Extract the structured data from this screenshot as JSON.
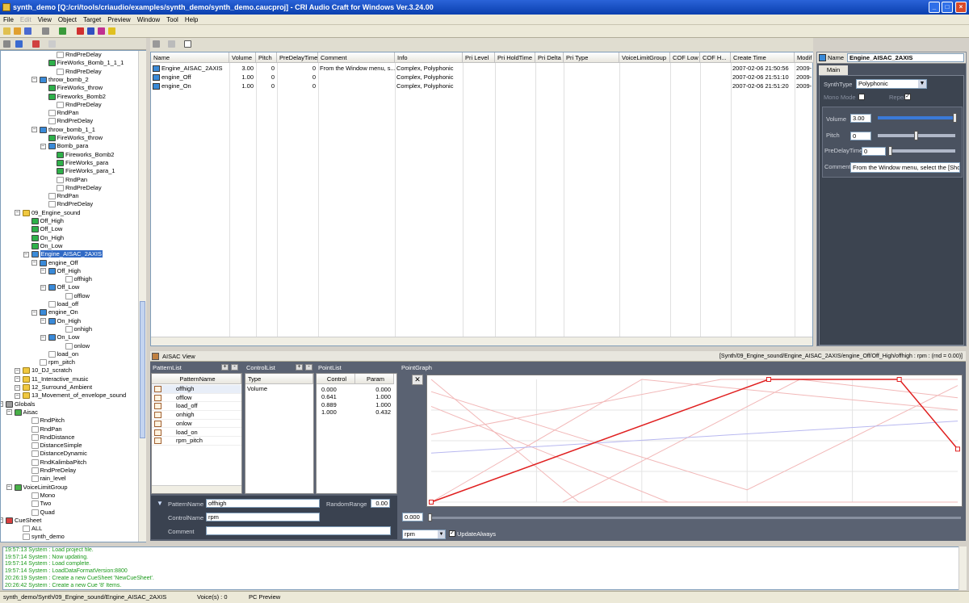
{
  "window": {
    "title": "synth_demo [Q:/cri/tools/criaudio/examples/synth_demo/synth_demo.caucproj] - CRI Audio Craft for Windows Ver.3.24.00"
  },
  "menu": [
    {
      "label": "File",
      "disabled": false
    },
    {
      "label": "Edit",
      "disabled": true
    },
    {
      "label": "View",
      "disabled": false
    },
    {
      "label": "Object",
      "disabled": false
    },
    {
      "label": "Target",
      "disabled": false
    },
    {
      "label": "Preview",
      "disabled": false
    },
    {
      "label": "Window",
      "disabled": false
    },
    {
      "label": "Tool",
      "disabled": false
    },
    {
      "label": "Help",
      "disabled": false
    }
  ],
  "tree": [
    {
      "label": "RndPreDelay",
      "icon": "d",
      "indent": 6
    },
    {
      "label": "FireWorks_Bomb_1_1_1",
      "icon": "g",
      "indent": 5
    },
    {
      "label": "RndPreDelay",
      "icon": "d",
      "indent": 6
    },
    {
      "label": "throw_bomb_2",
      "icon": "b",
      "indent": 4
    },
    {
      "label": "FireWorks_throw",
      "icon": "g",
      "indent": 5
    },
    {
      "label": "Fireworks_Bomb2",
      "icon": "g",
      "indent": 5
    },
    {
      "label": "RndPreDelay",
      "icon": "d",
      "indent": 6
    },
    {
      "label": "RndPan",
      "icon": "d",
      "indent": 5
    },
    {
      "label": "RndPreDelay",
      "icon": "d",
      "indent": 5
    },
    {
      "label": "throw_bomb_1_1",
      "icon": "b",
      "indent": 4
    },
    {
      "label": "FireWorks_throw",
      "icon": "g",
      "indent": 5
    },
    {
      "label": "Bomb_para",
      "icon": "b",
      "indent": 5
    },
    {
      "label": "Fireworks_Bomb2",
      "icon": "g",
      "indent": 6
    },
    {
      "label": "FireWorks_para",
      "icon": "g",
      "indent": 6
    },
    {
      "label": "FireWorks_para_1",
      "icon": "g",
      "indent": 6
    },
    {
      "label": "RndPan",
      "icon": "d",
      "indent": 6
    },
    {
      "label": "RndPreDelay",
      "icon": "d",
      "indent": 6
    },
    {
      "label": "RndPan",
      "icon": "d",
      "indent": 5
    },
    {
      "label": "RndPreDelay",
      "icon": "d",
      "indent": 5
    },
    {
      "label": "09_Engine_sound",
      "icon": "f",
      "indent": 2
    },
    {
      "label": "Off_High",
      "icon": "g",
      "indent": 3
    },
    {
      "label": "Off_Low",
      "icon": "g",
      "indent": 3
    },
    {
      "label": "On_High",
      "icon": "g",
      "indent": 3
    },
    {
      "label": "On_Low",
      "icon": "g",
      "indent": 3
    },
    {
      "label": "Engine_AISAC_2AXIS",
      "icon": "b",
      "indent": 3,
      "selected": true
    },
    {
      "label": "engine_Off",
      "icon": "b",
      "indent": 4
    },
    {
      "label": "Off_High",
      "icon": "b",
      "indent": 5
    },
    {
      "label": "offhigh",
      "icon": "d",
      "indent": 7
    },
    {
      "label": "Off_Low",
      "icon": "b",
      "indent": 5
    },
    {
      "label": "offlow",
      "icon": "d",
      "indent": 7
    },
    {
      "label": "load_off",
      "icon": "d",
      "indent": 5
    },
    {
      "label": "engine_On",
      "icon": "b",
      "indent": 4
    },
    {
      "label": "On_High",
      "icon": "b",
      "indent": 5
    },
    {
      "label": "onhigh",
      "icon": "d",
      "indent": 7
    },
    {
      "label": "On_Low",
      "icon": "b",
      "indent": 5
    },
    {
      "label": "onlow",
      "icon": "d",
      "indent": 7
    },
    {
      "label": "load_on",
      "icon": "d",
      "indent": 5
    },
    {
      "label": "rpm_pitch",
      "icon": "d",
      "indent": 4
    },
    {
      "label": "10_DJ_scratch",
      "icon": "f",
      "indent": 2
    },
    {
      "label": "11_Interactive_music",
      "icon": "f",
      "indent": 2
    },
    {
      "label": "12_Surround_Ambient",
      "icon": "f",
      "indent": 2
    },
    {
      "label": "13_Movement_of_envelope_sound",
      "icon": "f",
      "indent": 2
    },
    {
      "label": "Globals",
      "icon": "gf",
      "indent": 0
    },
    {
      "label": "Aisac",
      "icon": "gr",
      "indent": 1
    },
    {
      "label": "RndPitch",
      "icon": "d",
      "indent": 3
    },
    {
      "label": "RndPan",
      "icon": "d",
      "indent": 3
    },
    {
      "label": "RndDistance",
      "icon": "d",
      "indent": 3
    },
    {
      "label": "DistanceSimple",
      "icon": "d",
      "indent": 3
    },
    {
      "label": "DistanceDynamic",
      "icon": "d",
      "indent": 3
    },
    {
      "label": "RndKalimbaPitch",
      "icon": "d",
      "indent": 3
    },
    {
      "label": "RndPreDelay",
      "icon": "d",
      "indent": 3
    },
    {
      "label": "rain_level",
      "icon": "d",
      "indent": 3
    },
    {
      "label": "VoiceLimitGroup",
      "icon": "gr",
      "indent": 1
    },
    {
      "label": "Mono",
      "icon": "d",
      "indent": 3
    },
    {
      "label": "Two",
      "icon": "d",
      "indent": 3
    },
    {
      "label": "Quad",
      "icon": "d",
      "indent": 3
    },
    {
      "label": "CueSheet",
      "icon": "r",
      "indent": 0
    },
    {
      "label": "ALL",
      "icon": "d",
      "indent": 2
    },
    {
      "label": "synth_demo",
      "icon": "d",
      "indent": 2
    }
  ],
  "table": {
    "columns": [
      "Name",
      "Volume",
      "Pitch",
      "PreDelayTime",
      "Comment",
      "Info",
      "Pri Level",
      "Pri HoldTime",
      "Pri Delta",
      "Pri Type",
      "VoiceLimitGroup",
      "COF Low",
      "COF H...",
      "Create Time",
      "Modif"
    ],
    "rows": [
      [
        "Engine_AISAC_2AXIS",
        "3.00",
        "0",
        "0",
        "From the Window menu, s...",
        "Complex, Polyphonic",
        "",
        "",
        "",
        "",
        "",
        "",
        "",
        "2007-02-06 21:50:56",
        "2009-"
      ],
      [
        "engine_Off",
        "1.00",
        "0",
        "0",
        "",
        "Complex, Polyphonic",
        "",
        "",
        "",
        "",
        "",
        "",
        "",
        "2007-02-06 21:51:10",
        "2009-"
      ],
      [
        "engine_On",
        "1.00",
        "0",
        "0",
        "",
        "Complex, Polyphonic",
        "",
        "",
        "",
        "",
        "",
        "",
        "",
        "2007-02-06 21:51:20",
        "2009-"
      ]
    ]
  },
  "props": {
    "name_label": "Name",
    "name_value": "Engine_AISAC_2AXIS",
    "tab": "Main",
    "synth_type_label": "SynthType",
    "synth_type_value": "Polyphonic",
    "mono_label": "Mono Mode",
    "repeat_label": "Repeat",
    "volume_label": "Volume",
    "volume_value": "3.00",
    "volume_level": 1.0,
    "pitch_label": "Pitch",
    "pitch_value": "0",
    "pitch_level": 0.5,
    "predelay_label": "PreDelayTime",
    "predelay_value": "0",
    "predelay_level": 0.0,
    "comment_label": "Comment",
    "comment_value": "From the Window menu, select the [Show A"
  },
  "aisac": {
    "title": "AISAC View",
    "path": "[Synth/09_Engine_sound/Engine_AISAC_2AXIS/engine_Off/Off_High/offhigh : rpm : (rnd = 0.00)]",
    "pattern_list_label": "PatternList",
    "pattern_header": "PatternName",
    "patterns": [
      "offhigh",
      "offlow",
      "load_off",
      "onhigh",
      "onlow",
      "load_on",
      "rpm_pitch"
    ],
    "control_list_label": "ControlList",
    "control_header": "Type",
    "controls": [
      "Volume"
    ],
    "point_list_label": "PointList",
    "point_headers": [
      "Control",
      "Param"
    ],
    "points": [
      [
        "0.000",
        "0.000"
      ],
      [
        "0.641",
        "1.000"
      ],
      [
        "0.889",
        "1.000"
      ],
      [
        "1.000",
        "0.432"
      ]
    ],
    "graph_label": "PointGraph",
    "pattern_name_label": "PatternName",
    "pattern_name_value": "offhigh",
    "random_range_label": "RandomRange",
    "random_range_value": "0.00",
    "control_name_label": "ControlName",
    "control_name_value": "rpm",
    "comment_label": "Comment",
    "cursor_value": "0.000",
    "control_select": "rpm",
    "update_label": "UpdateAlways"
  },
  "log": [
    "19:57:13 System : Load project file.",
    "19:57:14 System : Now updating.",
    "19:57:14 System : Load complete.",
    "19:57:14 System : LoadDataFormatVersion:8800",
    "20:26:19 System : Create a new CueSheet 'NewCueSheet'.",
    "20:26:42 System : Create a new Cue '8' Items."
  ],
  "status": {
    "path": "synth_demo/Synth/09_Engine_sound/Engine_AISAC_2AXIS",
    "voices": "Voice(s) : 0",
    "mode": "PC Preview"
  }
}
